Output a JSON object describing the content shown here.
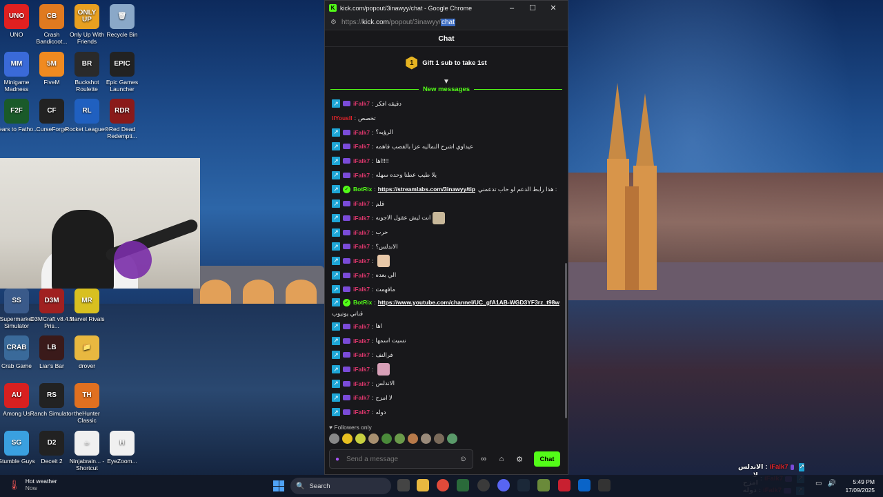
{
  "desktop": {
    "icons": [
      {
        "label": "UNO",
        "abbr": "UNO",
        "color": "#e02020"
      },
      {
        "label": "Crash Bandicoot...",
        "abbr": "CB",
        "color": "#e07a20"
      },
      {
        "label": "Only Up With Friends",
        "abbr": "ONLY UP",
        "color": "#e8a020"
      },
      {
        "label": "Recycle Bin",
        "abbr": "🗑",
        "color": "#8aa8c8"
      },
      {
        "label": "Minigame Madness",
        "abbr": "MM",
        "color": "#3a6ad8"
      },
      {
        "label": "FiveM",
        "abbr": "5M",
        "color": "#f08a20"
      },
      {
        "label": "Buckshot Roulette",
        "abbr": "BR",
        "color": "#2a2a2a"
      },
      {
        "label": "Epic Games Launcher",
        "abbr": "EPIC",
        "color": "#222"
      },
      {
        "label": "Fears to Fatho...",
        "abbr": "F2F",
        "color": "#1a5a2a"
      },
      {
        "label": "CurseForge",
        "abbr": "CF",
        "color": "#222"
      },
      {
        "label": "Rocket League®",
        "abbr": "RL",
        "color": "#2060c0"
      },
      {
        "label": "Red Dead Redempti...",
        "abbr": "RDR",
        "color": "#8a1a1a"
      },
      {
        "label": "Supermarket Simulator",
        "abbr": "SS",
        "color": "#3a5a8a"
      },
      {
        "label": "D3MCraft v8.4.1 Pris...",
        "abbr": "D3M",
        "color": "#a02020"
      },
      {
        "label": "Marvel Rivals",
        "abbr": "MR",
        "color": "#d8c020"
      },
      {
        "label": "Crab Game",
        "abbr": "CRAB",
        "color": "#3a6a9a"
      },
      {
        "label": "Liar's Bar",
        "abbr": "LB",
        "color": "#3a1a1a"
      },
      {
        "label": "drover",
        "abbr": "📁",
        "color": "#e8b840"
      },
      {
        "label": "Among Us",
        "abbr": "AU",
        "color": "#d82020"
      },
      {
        "label": "Ranch Simulator",
        "abbr": "RS",
        "color": "#222"
      },
      {
        "label": "theHunter Classic",
        "abbr": "TH",
        "color": "#e07020"
      },
      {
        "label": "Stumble Guys",
        "abbr": "SG",
        "color": "#3aa0e0"
      },
      {
        "label": "Deceit 2",
        "abbr": "D2",
        "color": "#222"
      },
      {
        "label": "Ninjabrain... - Shortcut",
        "abbr": "☕",
        "color": "#f0f0f0"
      },
      {
        "label": "EyeZoom...",
        "abbr": "H",
        "color": "#f0f0f0"
      }
    ]
  },
  "browser": {
    "title": "kick.com/popout/3inawyy/chat - Google Chrome",
    "url_scheme": "https://",
    "url_host": "kick.com",
    "url_path": "/popout/3inawyy/",
    "url_selected": "chat"
  },
  "chat": {
    "header": "Chat",
    "gift_count": "1",
    "gift_text": "Gift 1 sub to take 1st",
    "new_messages": "New messages",
    "messages": [
      {
        "user": "iFalk7",
        "text": "دقيقه افكر",
        "style": "pink"
      },
      {
        "user": "IIYousII",
        "text": "تخصص",
        "style": "red"
      },
      {
        "user": "iFalk7",
        "text": "الرؤيه؟",
        "style": "pink"
      },
      {
        "user": "iFalk7",
        "text": "عيداوي اشرح النماليه عزا بالفصب فاهمه",
        "style": "pink"
      },
      {
        "user": "iFalk7",
        "text": "اها!!!!",
        "style": "pink"
      },
      {
        "user": "iFalk7",
        "text": "يلا طيب عطنا وحده سهله",
        "style": "pink"
      },
      {
        "user": "BotRix",
        "link": "https://streamlabs.com/3inawyy/tip",
        "text": "هذا رابط الدعم لو حاب تدعمني :",
        "style": "bot"
      },
      {
        "user": "iFalk7",
        "text": "قلم",
        "style": "pink"
      },
      {
        "user": "iFalk7",
        "text": "انت ليش عقول الاجوبه",
        "style": "pink",
        "emote": "#c8b89a"
      },
      {
        "user": "iFalk7",
        "text": "حرب",
        "style": "pink"
      },
      {
        "user": "iFalk7",
        "text": "الاندلس؟",
        "style": "pink"
      },
      {
        "user": "iFalk7",
        "text": "",
        "style": "pink",
        "emote": "#e8c8a8"
      },
      {
        "user": "iFalk7",
        "text": "الي بعده",
        "style": "pink"
      },
      {
        "user": "iFalk7",
        "text": "مافهمت",
        "style": "pink"
      },
      {
        "user": "BotRix",
        "link": "https://www.youtube.com/channel/UC_gfA1AB-WGD3YF3rz_t98w",
        "text": "قناتي يوتيوب",
        "style": "bot"
      },
      {
        "user": "iFalk7",
        "text": "اها",
        "style": "pink"
      },
      {
        "user": "iFalk7",
        "text": "نسيت اسمها",
        "style": "pink"
      },
      {
        "user": "iFalk7",
        "text": "فرالنف",
        "style": "pink"
      },
      {
        "user": "iFalk7",
        "text": "",
        "style": "pink",
        "emote": "#d8a0b8"
      },
      {
        "user": "iFalk7",
        "text": "الاندلس",
        "style": "pink"
      },
      {
        "user": "iFalk7",
        "text": "لا امزح",
        "style": "pink"
      },
      {
        "user": "iFalk7",
        "text": "دوله",
        "style": "pink"
      }
    ],
    "followers_only": "Followers only",
    "input_placeholder": "Send a message",
    "send_label": "Chat"
  },
  "overlay": {
    "lines": [
      {
        "user": "iFalk7",
        "text": "الاندلس"
      },
      {
        "user": "iFalk7",
        "text": "لا امزح"
      },
      {
        "user": "iFalk7",
        "text": "دوله"
      }
    ]
  },
  "taskbar": {
    "weather_title": "Hot weather",
    "weather_sub": "Now",
    "search_label": "Search",
    "time": "5:49 PM",
    "date": "17/09/2025"
  }
}
